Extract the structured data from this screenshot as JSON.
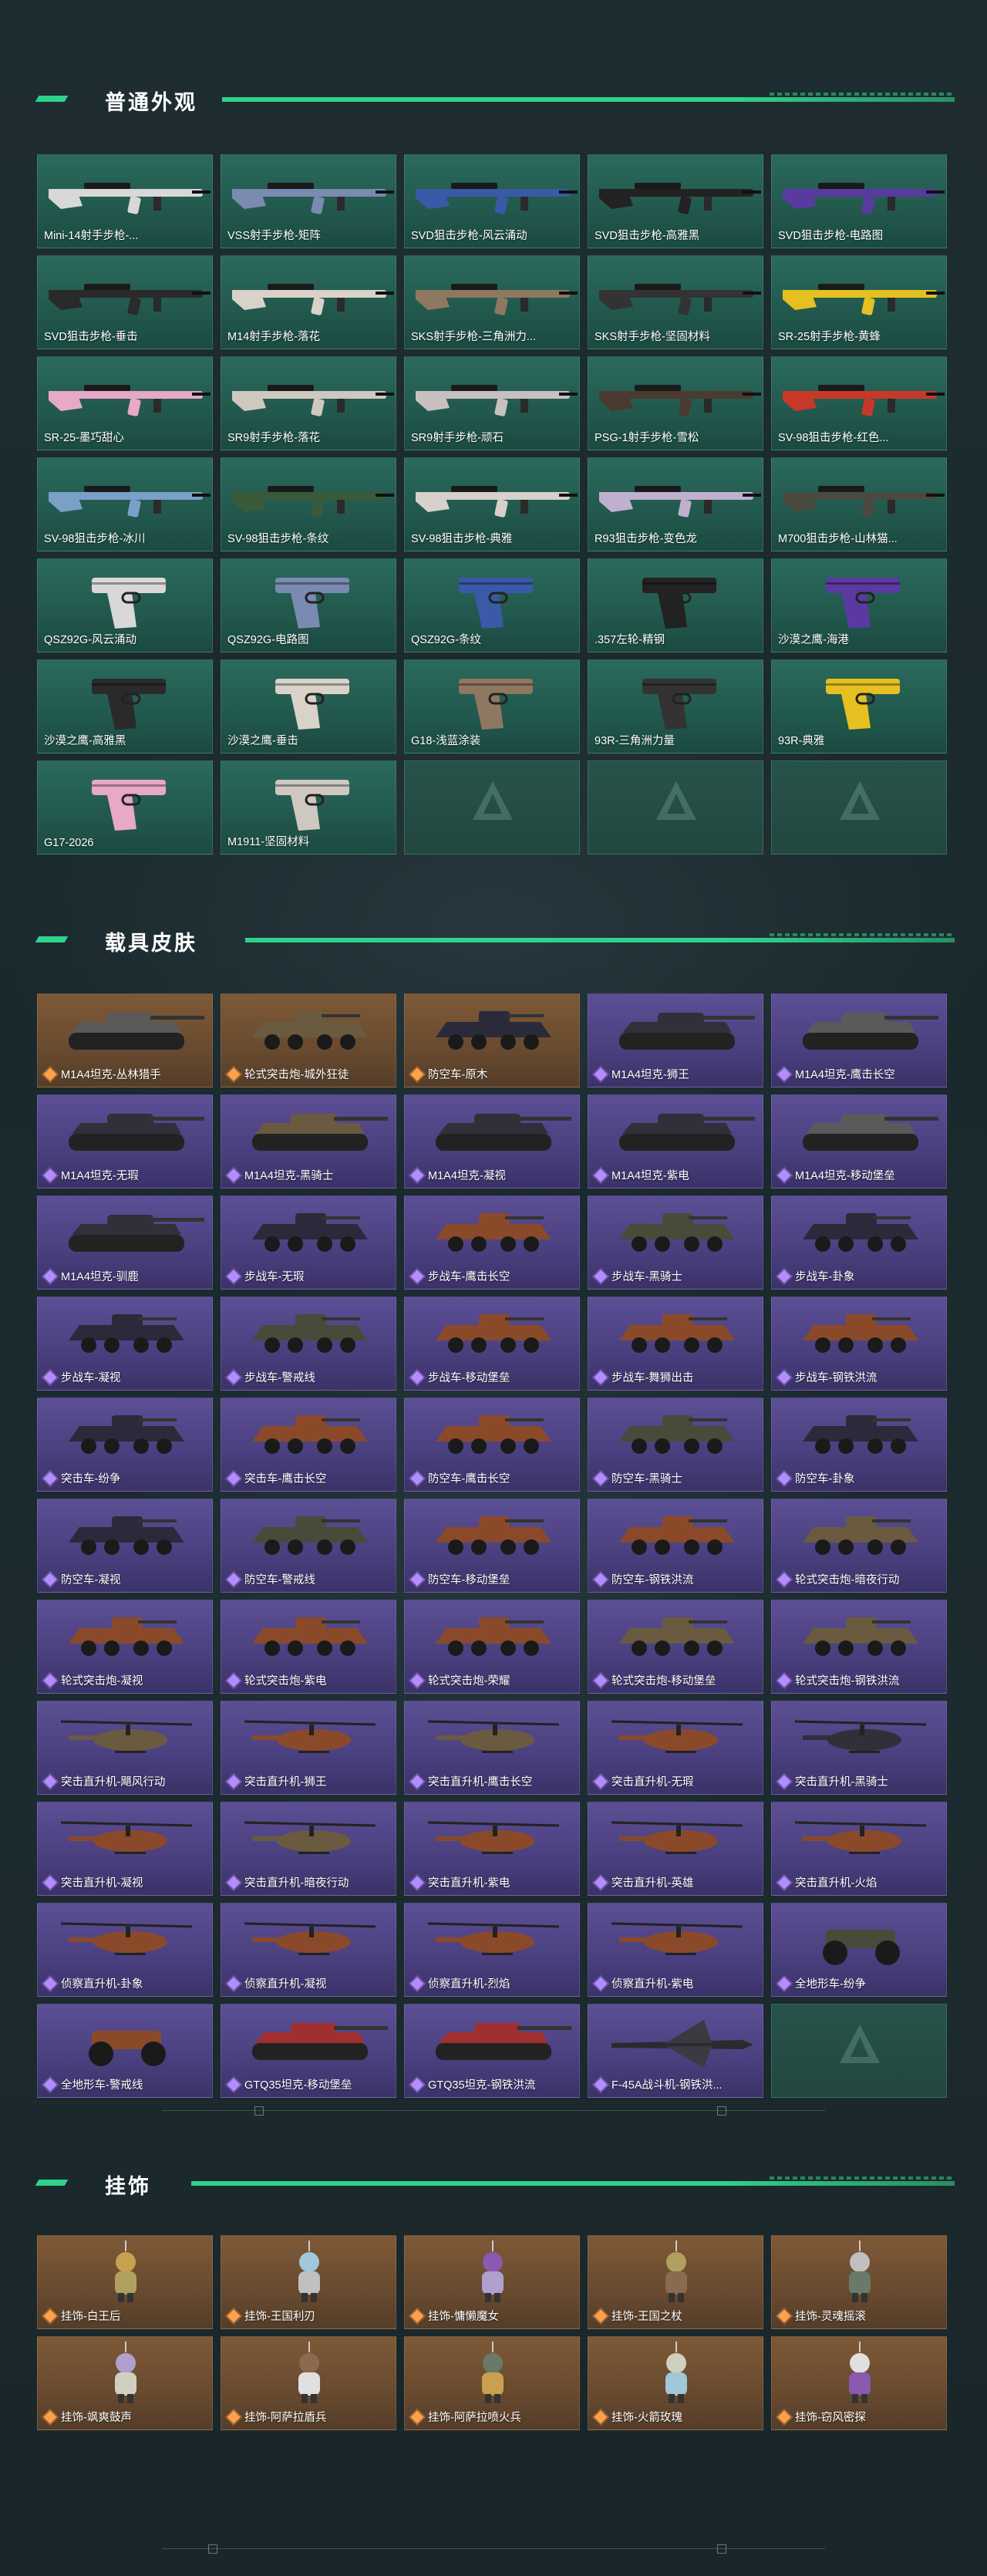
{
  "sections": [
    {
      "title": "普通外观",
      "items": [
        "Mini-14射手步枪-...",
        "VSS射手步枪-矩阵",
        "SVD狙击步枪-风云涌动",
        "SVD狙击步枪-高雅黑",
        "SVD狙击步枪-电路图",
        "SVD狙击步枪-垂击",
        "M14射手步枪-落花",
        "SKS射手步枪-三角洲力...",
        "SKS射手步枪-坚固材料",
        "SR-25射手步枪-黄蜂",
        "SR-25-墨巧甜心",
        "SR9射手步枪-落花",
        "SR9射手步枪-顽石",
        "PSG-1射手步枪-雪松",
        "SV-98狙击步枪-红色...",
        "SV-98狙击步枪-冰川",
        "SV-98狙击步枪-条纹",
        "SV-98狙击步枪-典雅",
        "R93狙击步枪-变色龙",
        "M700狙击步枪-山林猫...",
        "QSZ92G-风云涌动",
        "QSZ92G-电路图",
        "QSZ92G-条纹",
        ".357左轮-精钢",
        "沙漠之鹰-海港",
        "沙漠之鹰-高雅黑",
        "沙漠之鹰-垂击",
        "G18-浅蓝涂装",
        "93R-三角洲力量",
        "93R-典雅",
        "G17-2026",
        "M1911-坚固材料"
      ]
    },
    {
      "title": "载具皮肤",
      "items": [
        "M1A4坦克-丛林猎手",
        "轮式突击炮-城外狂徒",
        "防空车-原木",
        "M1A4坦克-狮王",
        "M1A4坦克-鹰击长空",
        "M1A4坦克-无瑕",
        "M1A4坦克-黑骑士",
        "M1A4坦克-凝视",
        "M1A4坦克-紫电",
        "M1A4坦克-移动堡垒",
        "M1A4坦克-驯鹿",
        "步战车-无瑕",
        "步战车-鹰击长空",
        "步战车-黑骑士",
        "步战车-卦象",
        "步战车-凝视",
        "步战车-警戒线",
        "步战车-移动堡垒",
        "步战车-舞狮出击",
        "步战车-钢铁洪流",
        "突击车-纷争",
        "突击车-鹰击长空",
        "防空车-鹰击长空",
        "防空车-黑骑士",
        "防空车-卦象",
        "防空车-凝视",
        "防空车-警戒线",
        "防空车-移动堡垒",
        "防空车-钢铁洪流",
        "轮式突击炮-暗夜行动",
        "轮式突击炮-凝视",
        "轮式突击炮-紫电",
        "轮式突击炮-荣耀",
        "轮式突击炮-移动堡垒",
        "轮式突击炮-钢铁洪流",
        "突击直升机-飓风行动",
        "突击直升机-狮王",
        "突击直升机-鹰击长空",
        "突击直升机-无瑕",
        "突击直升机-黑骑士",
        "突击直升机-凝视",
        "突击直升机-暗夜行动",
        "突击直升机-紫电",
        "突击直升机-英雄",
        "突击直升机-火焰",
        "侦察直升机-卦象",
        "侦察直升机-凝视",
        "侦察直升机-烈焰",
        "侦察直升机-紫电",
        "全地形车-纷争",
        "全地形车-警戒线",
        "GTQ35坦克-移动堡垒",
        "GTQ35坦克-钢铁洪流",
        "F-45A战斗机-钢铁洪..."
      ]
    },
    {
      "title": "挂饰",
      "items": [
        "挂饰-白王后",
        "挂饰-王国利刃",
        "挂饰-慵懒魔女",
        "挂饰-王国之杖",
        "挂饰-灵魂摇滚",
        "挂饰-飒爽鼓声",
        "挂饰-阿萨拉盾兵",
        "挂饰-阿萨拉喷火兵",
        "挂饰-火箭玫瑰",
        "挂饰-窃风密探"
      ]
    }
  ],
  "colors": {
    "accent": "#2fd28a",
    "green_card": "#2a6a5c",
    "purple_card": "#5c4f95",
    "orange_card": "#7e5936"
  },
  "icons": {
    "rarity": "diamond-icon",
    "placeholder": "delta-logo-icon"
  }
}
